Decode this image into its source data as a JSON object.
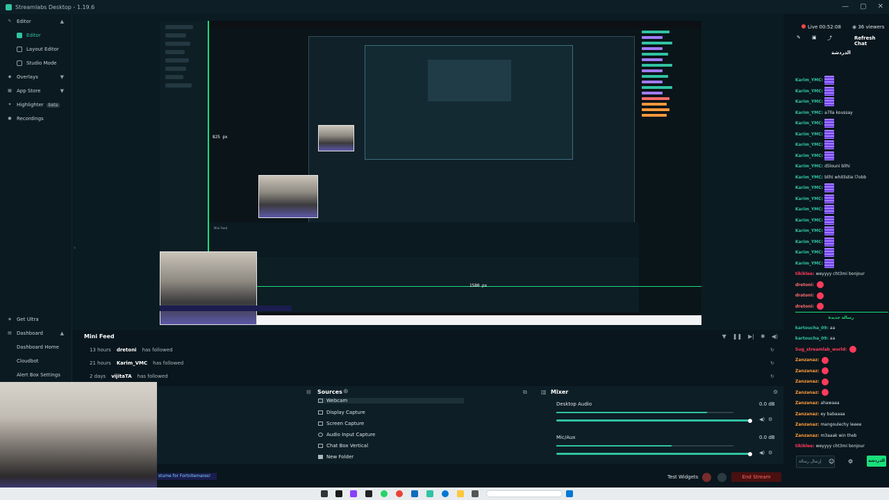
{
  "app": {
    "title": "Streamlabs Desktop - 1.19.6",
    "window_controls": [
      "—",
      "▢",
      "✕"
    ]
  },
  "sidebar": {
    "items": [
      {
        "label": "Editor",
        "expanded": true
      },
      {
        "label": "Editor",
        "active": true
      },
      {
        "label": "Layout Editor"
      },
      {
        "label": "Studio Mode"
      },
      {
        "label": "Overlays"
      },
      {
        "label": "App Store"
      },
      {
        "label": "Highlighter",
        "badge": "beta"
      },
      {
        "label": "Recordings"
      }
    ],
    "bottom": [
      {
        "label": "Get Ultra"
      },
      {
        "label": "Dashboard"
      },
      {
        "label": "Dashboard Home"
      },
      {
        "label": "Cloudbot"
      },
      {
        "label": "Alert Box Settings"
      }
    ]
  },
  "preview": {
    "dimension_height": "825 px",
    "dimension_width": "1580 px",
    "fortnite_text": "stume for Fortnitemares!"
  },
  "minifeed": {
    "title": "Mini Feed",
    "rows": [
      {
        "time": "13 hours",
        "user": "dretoni",
        "action": "has followed"
      },
      {
        "time": "21 hours",
        "user": "Karim_VMC",
        "action": "has followed"
      },
      {
        "time": "2 days",
        "user": "vijitaTA",
        "action": "has followed"
      }
    ]
  },
  "sources": {
    "title": "Sources",
    "items": [
      "Webcam",
      "Display Capture",
      "Screen Capture",
      "Audio Input Capture",
      "Chat Box Vertical",
      "New Folder"
    ]
  },
  "mixer": {
    "title": "Mixer",
    "channels": [
      {
        "name": "Desktop Audio",
        "db": "0.0 dB",
        "level": 0.85
      },
      {
        "name": "Mic/Aux",
        "db": "0.0 dB",
        "level": 0.65
      }
    ]
  },
  "footer": {
    "test_widgets": "Test Widgets",
    "end_stream": "End Stream"
  },
  "chat": {
    "live": "Live 00:52:08",
    "viewers": "36 viewers",
    "refresh": "Refresh Chat",
    "tab": "الدردشة",
    "input_placeholder": "إرسال رسالة",
    "send": "الدردشة",
    "messages": [
      {
        "user": "Karim_YMC:",
        "color": "#31c3a2",
        "emote": true
      },
      {
        "user": "Karim_YMC:",
        "color": "#31c3a2",
        "emote": true
      },
      {
        "user": "Karim_YMC:",
        "color": "#31c3a2",
        "emote": true
      },
      {
        "user": "Karim_YMC:",
        "color": "#31c3a2",
        "text": "a7lla koussay"
      },
      {
        "user": "Karim_YMC:",
        "color": "#31c3a2",
        "emote": true
      },
      {
        "user": "Karim_YMC:",
        "color": "#31c3a2",
        "emote": true
      },
      {
        "user": "Karim_YMC:",
        "color": "#31c3a2",
        "emote": true
      },
      {
        "user": "Karim_YMC:",
        "color": "#31c3a2",
        "emote": true
      },
      {
        "user": "Karim_YMC:",
        "color": "#31c3a2",
        "text": "d5louni bllhi"
      },
      {
        "user": "Karim_YMC:",
        "color": "#31c3a2",
        "text": "bllhi whitlistie l7obb"
      },
      {
        "user": "Karim_YMC:",
        "color": "#31c3a2",
        "emote": true
      },
      {
        "user": "Karim_YMC:",
        "color": "#31c3a2",
        "emote": true
      },
      {
        "user": "Karim_YMC:",
        "color": "#31c3a2",
        "emote": true
      },
      {
        "user": "Karim_YMC:",
        "color": "#31c3a2",
        "emote": true
      },
      {
        "user": "Karim_YMC:",
        "color": "#31c3a2",
        "emote": true
      },
      {
        "user": "Karim_YMC:",
        "color": "#31c3a2",
        "emote": true
      },
      {
        "user": "Karim_YMC:",
        "color": "#31c3a2",
        "emote": true
      },
      {
        "user": "Karim_YMC:",
        "color": "#31c3a2",
        "emote": true
      },
      {
        "user": "tikiklee:",
        "color": "#ff3b5c",
        "text": "weyyyy cht3mi bonjour"
      },
      {
        "user": "dretoni:",
        "color": "#ff6b6b",
        "heart": true
      },
      {
        "user": "dratoni:",
        "color": "#ff6b6b",
        "heart": true
      },
      {
        "user": "dretoni:",
        "color": "#ff6b6b",
        "heart": true
      },
      {
        "user": "رسالة جديدة",
        "color": "#19e07b",
        "divider": true
      },
      {
        "user": "kartoucha_09:",
        "color": "#31c3a2",
        "text": "aa"
      },
      {
        "user": "kartoucha_09:",
        "color": "#31c3a2",
        "text": "aa"
      },
      {
        "user": "Sug_streamlab_world:",
        "color": "#ff3b5c",
        "heart": true
      },
      {
        "user": "Zanzanaz:",
        "color": "#ff9a3c",
        "heart": true
      },
      {
        "user": "Zanzanaz:",
        "color": "#ff9a3c",
        "heart": true
      },
      {
        "user": "Zanzanaz:",
        "color": "#ff9a3c",
        "heart": true
      },
      {
        "user": "Zanzanaz:",
        "color": "#ff9a3c",
        "heart": true
      },
      {
        "user": "Zanzanaz:",
        "color": "#ff9a3c",
        "text": "ahawaaa"
      },
      {
        "user": "Zanzanaz:",
        "color": "#ff9a3c",
        "text": "ey babaaaa"
      },
      {
        "user": "Zanzanaz:",
        "color": "#ff9a3c",
        "text": "mangoulechy leeee"
      },
      {
        "user": "Zanzanaz:",
        "color": "#ff9a3c",
        "text": "m3aaak win theb"
      },
      {
        "user": "tikiklee:",
        "color": "#ff3b5c",
        "text": "weyyyy cht3mi bonjour"
      }
    ]
  }
}
